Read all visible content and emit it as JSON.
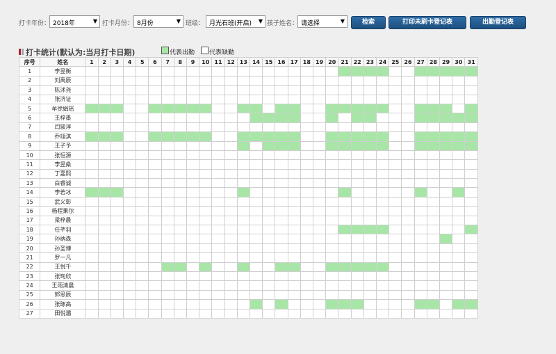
{
  "filters": {
    "year_label": "打卡年份：",
    "year_value": "2018年",
    "month_label": "打卡月份：",
    "month_value": "8月份",
    "class_label": "班级：",
    "class_value": "月光石班(开启)",
    "child_label": "孩子姓名：",
    "child_value": "请选择",
    "dropdown_arrow": "▼"
  },
  "buttons": {
    "search": "检索",
    "print_unswiped": "打印未刷卡登记表",
    "attendance_register": "出勤登记表"
  },
  "stats": {
    "title": "打卡统计(默认为:当月打卡日期)",
    "legend_present": "代表出勤",
    "legend_absent": "代表缺勤",
    "present_color": "#a8e6a8",
    "absent_color": "#ffffff"
  },
  "table": {
    "seq_header": "序号",
    "name_header": "姓名",
    "days": [
      "1",
      "2",
      "3",
      "4",
      "5",
      "6",
      "7",
      "8",
      "9",
      "10",
      "11",
      "12",
      "13",
      "14",
      "15",
      "16",
      "17",
      "18",
      "19",
      "20",
      "21",
      "22",
      "23",
      "24",
      "25",
      "26",
      "27",
      "28",
      "29",
      "30",
      "31"
    ],
    "rows": [
      {
        "seq": "1",
        "name": "李昱衡",
        "present": [
          21,
          22,
          23,
          24,
          27,
          28,
          29,
          30,
          31
        ]
      },
      {
        "seq": "2",
        "name": "刘禹辰",
        "present": []
      },
      {
        "seq": "3",
        "name": "陈沭尧",
        "present": []
      },
      {
        "seq": "4",
        "name": "张济证",
        "present": []
      },
      {
        "seq": "5",
        "name": "牟徐娟瑶",
        "present": [
          1,
          2,
          3,
          6,
          7,
          8,
          9,
          10,
          13,
          14,
          16,
          17,
          20,
          21,
          22,
          23,
          24,
          27,
          28,
          29,
          31
        ]
      },
      {
        "seq": "6",
        "name": "王梓墨",
        "present": [
          14,
          15,
          16,
          17,
          20,
          22,
          23,
          27,
          28,
          29,
          30,
          31
        ]
      },
      {
        "seq": "7",
        "name": "闫骏淳",
        "present": []
      },
      {
        "seq": "8",
        "name": "乔翊淇",
        "present": [
          1,
          2,
          3,
          6,
          7,
          8,
          9,
          10,
          13,
          14,
          15,
          16,
          17,
          20,
          21,
          22,
          23,
          24,
          27,
          28,
          29,
          30,
          31
        ]
      },
      {
        "seq": "9",
        "name": "王子予",
        "present": [
          13,
          15,
          16,
          17,
          20,
          21,
          22,
          23,
          24,
          27,
          28,
          29,
          30,
          31
        ]
      },
      {
        "seq": "10",
        "name": "张恒源",
        "present": []
      },
      {
        "seq": "11",
        "name": "李昱燊",
        "present": []
      },
      {
        "seq": "12",
        "name": "丁嘉熙",
        "present": []
      },
      {
        "seq": "13",
        "name": "白睿诚",
        "present": []
      },
      {
        "seq": "14",
        "name": "李若冰",
        "present": [
          1,
          2,
          3,
          13,
          21,
          27,
          30
        ]
      },
      {
        "seq": "15",
        "name": "武义彰",
        "present": []
      },
      {
        "seq": "16",
        "name": "杨程果尔",
        "present": []
      },
      {
        "seq": "17",
        "name": "梁梓晨",
        "present": []
      },
      {
        "seq": "18",
        "name": "任芊羽",
        "present": [
          21,
          22,
          23,
          24,
          31
        ]
      },
      {
        "seq": "19",
        "name": "孙纳森",
        "present": [
          29
        ]
      },
      {
        "seq": "20",
        "name": "孙圣博",
        "present": []
      },
      {
        "seq": "21",
        "name": "罗一凡",
        "present": []
      },
      {
        "seq": "22",
        "name": "王悦千",
        "present": [
          7,
          8,
          10,
          13,
          16,
          17,
          20,
          21,
          22,
          23,
          24
        ]
      },
      {
        "seq": "23",
        "name": "张珣欣",
        "present": []
      },
      {
        "seq": "24",
        "name": "王雨清晨",
        "present": []
      },
      {
        "seq": "25",
        "name": "郭思辰",
        "present": []
      },
      {
        "seq": "26",
        "name": "张琢高",
        "present": [
          14,
          16,
          20,
          21,
          22,
          27,
          28,
          30,
          31
        ]
      },
      {
        "seq": "27",
        "name": "田悦灞",
        "present": []
      }
    ]
  }
}
